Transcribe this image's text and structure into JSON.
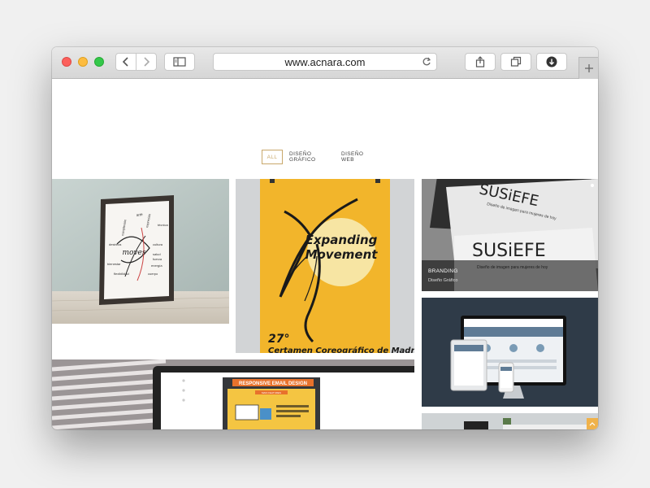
{
  "browser": {
    "url": "www.acnara.com",
    "icons": {
      "back": "chevron-left-icon",
      "forward": "chevron-right-icon",
      "sidebar": "sidebar-icon",
      "reload": "reload-icon",
      "share": "share-icon",
      "tabs": "tabs-icon",
      "download": "download-icon",
      "new_tab": "plus-icon"
    },
    "colors": {
      "close": "#fc605c",
      "minimize": "#fdbc40",
      "zoom": "#34c84a"
    }
  },
  "filters": [
    {
      "label": "ALL",
      "active": true
    },
    {
      "label": "DISEÑO GRÁFICO",
      "active": false
    },
    {
      "label": "DISEÑO WEB",
      "active": false
    }
  ],
  "portfolio": {
    "poster_words": [
      "arte",
      "expresión",
      "técnica",
      "complexión",
      "destreza",
      "cultura",
      "moves",
      "bienestar",
      "fuerza",
      "energía",
      "flexibilidad",
      "cuerpo",
      "salud"
    ],
    "dance_poster": {
      "title_line1": "Expanding",
      "title_line2": "Movement",
      "edition": "27°",
      "event": "Certamen Coreográfico de Madrid"
    },
    "business_card": {
      "brand": "SUSiEFE",
      "tagline": "Diseño de imagen para mujeres de hoy",
      "caption_title": "BRANDING",
      "caption_sub": "Diseño Gráfico"
    },
    "email_mockup": {
      "banner": "RESPONSIVE EMAIL DESIGN",
      "section_label": "MAIN FEATURES"
    }
  },
  "accent_color": "#c9a86b"
}
